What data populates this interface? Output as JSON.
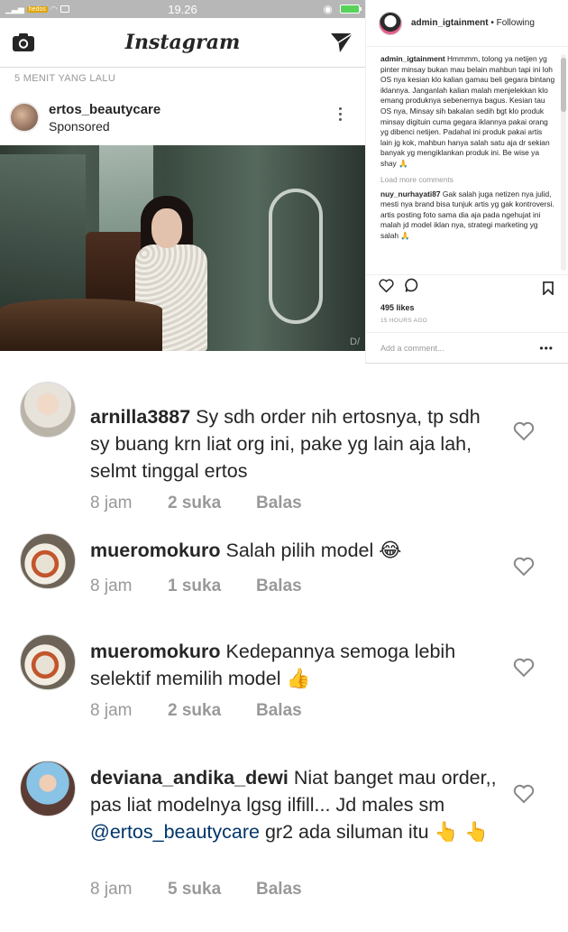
{
  "status_bar": {
    "time": "19.26",
    "carrier_badge": "hedos",
    "battery_color": "#59d25a"
  },
  "app_header": {
    "logo": "Instagram",
    "icons": [
      "camera-icon",
      "send-icon"
    ]
  },
  "feed": {
    "time_ago": "5 MENIT YANG LALU",
    "post": {
      "username": "ertos_beautycare",
      "label": "Sponsored",
      "image_watermark": "D/"
    }
  },
  "panel": {
    "handle": "admin_igtainment",
    "separator": " • ",
    "follow_status": "Following",
    "caption_user": "admin_igtainment",
    "caption_text": "Hmmmm, tolong ya netijen yg pinter minsay bukan mau belain mahbun tapi ini loh OS nya kesian klo kalian gamau beli gegara bintang iklannya. Janganlah kalian malah menjelekkan klo emang produknya sebenernya bagus. Kesian tau OS nya, Minsay sih bakalan sedih bgt klo produk minsay digituin cuma gegara iklannya pakai orang yg dibenci netijen. Padahal ini produk pakai artis lain jg kok, mahbun hanya salah satu aja dr sekian banyak yg mengiklankan produk ini. Be wise ya shay 🙏",
    "load_more": "Load more comments",
    "comment_user": "nuy_nurhayati87",
    "comment_text": "Gak salah juga netizen nya julid, mesti nya brand bisa tunjuk artis yg gak kontroversi. artis posting foto sama dia aja pada ngehujat ini malah jd model iklan nya, strategi marketing yg salah 🙏",
    "likes": "495 likes",
    "time": "15 HOURS AGO",
    "add_comment_placeholder": "Add a comment...",
    "more": "•••"
  },
  "comments": [
    {
      "username": "arnilla3887",
      "text": "Sy sdh order nih ertosnya, tp sdh sy buang krn liat org ini, pake yg lain aja lah, selmt tinggal ertos",
      "time": "8 jam",
      "likes": "2 suka",
      "reply": "Balas"
    },
    {
      "username": "mueromokuro",
      "text": "Salah pilih model",
      "emoji": "😂",
      "time": "8 jam",
      "likes": "1 suka",
      "reply": "Balas"
    },
    {
      "username": "mueromokuro",
      "text": "Kedepannya semoga lebih selektif memilih model",
      "emoji": "👍",
      "time": "8 jam",
      "likes": "2 suka",
      "reply": "Balas"
    },
    {
      "username": "deviana_andika_dewi",
      "text": "Niat banget mau order,, pas liat modelnya lgsg ilfill... Jd males sm",
      "mention": "@ertos_beautycare",
      "text_after": "gr2 ada siluman itu",
      "emoji": "👆 👆",
      "time": "8 jam",
      "likes": "5 suka",
      "reply": "Balas"
    }
  ]
}
